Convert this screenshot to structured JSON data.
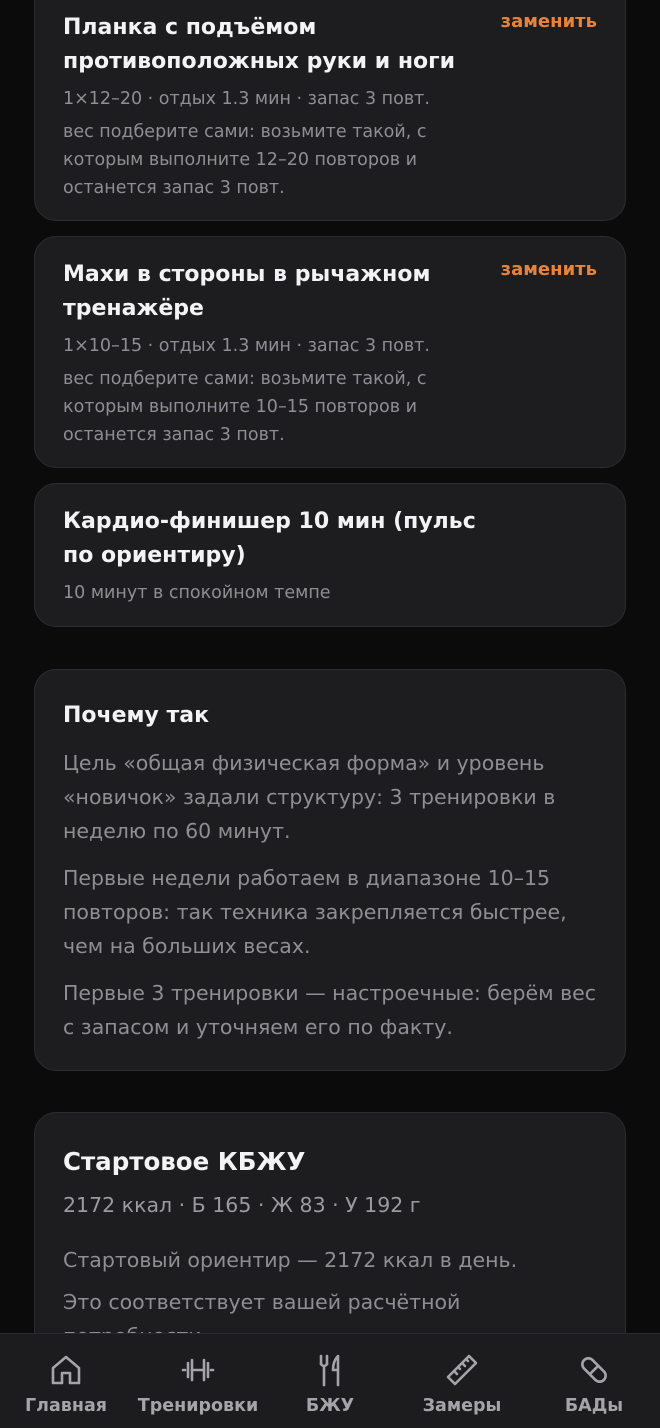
{
  "exercises": [
    {
      "title": "Планка с подъёмом противоположных руки и ноги",
      "meta": "1×12–20 · отдых 1.3 мин · запас 3 повт.",
      "note": "вес подберите сами: возьмите такой, с которым выполните 12–20 повторов и останется запас 3 повт.",
      "replace_label": "заменить"
    },
    {
      "title": "Махи в стороны в рычажном тренажёре",
      "meta": "1×10–15 · отдых 1.3 мин · запас 3 повт.",
      "note": "вес подберите сами: возьмите такой, с которым выполните 10–15 повторов и останется запас 3 повт.",
      "replace_label": "заменить"
    },
    {
      "title": "Кардио-финишер 10 мин (пульс по ориентиру)",
      "meta": "10 минут в спокойном темпе"
    }
  ],
  "why": {
    "title": "Почему так",
    "paragraphs": [
      "Цель «общая физическая форма» и уровень «новичок» задали структуру: 3 тренировки в неделю по 60 минут.",
      "Первые недели работаем в диапазоне 10–15 повторов: так техника закрепляется быстрее, чем на больших весах.",
      "Первые 3 тренировки — настроечные: берём вес с запасом и уточняем его по факту."
    ]
  },
  "kbju": {
    "title": "Стартовое КБЖУ",
    "macros": "2172 ккал · Б 165 · Ж 83 · У 192 г",
    "text1": "Стартовый ориентир — 2172 ккал в день.",
    "text2": "Это соответствует вашей расчётной потребности."
  },
  "tabbar": {
    "items": [
      {
        "label": "Главная",
        "icon": "home-icon"
      },
      {
        "label": "Тренировки",
        "icon": "dumbbell-icon"
      },
      {
        "label": "БЖУ",
        "icon": "fork-knife-icon"
      },
      {
        "label": "Замеры",
        "icon": "ruler-icon"
      },
      {
        "label": "БАДы",
        "icon": "pill-icon"
      }
    ]
  },
  "colors": {
    "background": "#0b0b0c",
    "card": "#1d1d20",
    "accent": "#e8843a",
    "muted_text": "#8e8e94"
  }
}
